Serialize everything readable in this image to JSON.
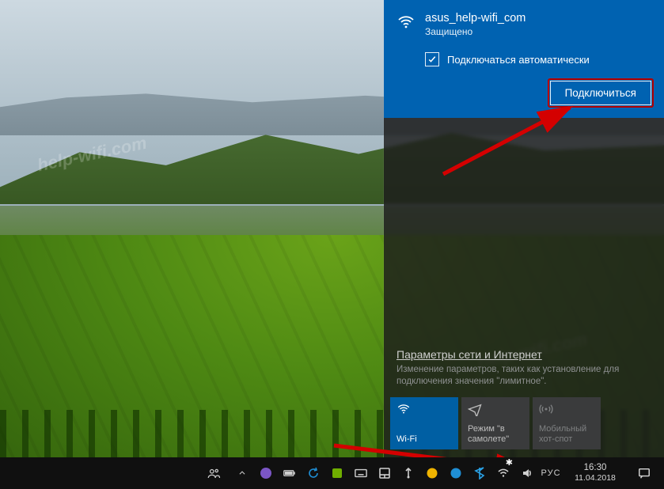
{
  "watermark": "help-wifi.com",
  "network": {
    "name": "asus_help-wifi_com",
    "status": "Защищено",
    "auto_connect_label": "Подключаться автоматически",
    "connect_label": "Подключиться"
  },
  "settings": {
    "link": "Параметры сети и Интернет",
    "sub": "Изменение параметров, таких как установление для подключения значения \"лимитное\"."
  },
  "tiles": {
    "wifi": "Wi-Fi",
    "airplane": "Режим \"в самолете\"",
    "hotspot": "Мобильный хот-спот"
  },
  "taskbar": {
    "lang": "РУС",
    "time": "16:30",
    "date": "11.04.2018"
  }
}
